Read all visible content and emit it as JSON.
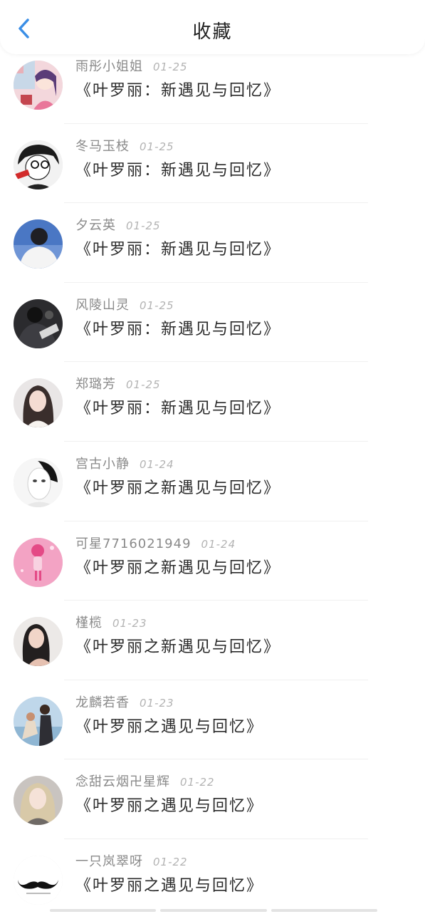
{
  "header": {
    "title": "收藏",
    "back_icon": "chevron-left-icon",
    "accent_color": "#3a8ee6"
  },
  "items": [
    {
      "username": "雨彤小姐姐",
      "date": "01-25",
      "title": "《叶罗丽：新遇见与回忆》",
      "avatar": "anime-girl-avatar"
    },
    {
      "username": "冬马玉枝",
      "date": "01-25",
      "title": "《叶罗丽：新遇见与回忆》",
      "avatar": "manga-boy-avatar"
    },
    {
      "username": "夕云英",
      "date": "01-25",
      "title": "《叶罗丽：新遇见与回忆》",
      "avatar": "boy-back-avatar"
    },
    {
      "username": "风陵山灵",
      "date": "01-25",
      "title": "《叶罗丽：新遇见与回忆》",
      "avatar": "dark-photo-avatar"
    },
    {
      "username": "郑璐芳",
      "date": "01-25",
      "title": "《叶罗丽：新遇见与回忆》",
      "avatar": "girl-photo-avatar"
    },
    {
      "username": "宫古小静",
      "date": "01-24",
      "title": "《叶罗丽之新遇见与回忆》",
      "avatar": "mask-avatar"
    },
    {
      "username": "可星7716021949",
      "date": "01-24",
      "title": "《叶罗丽之新遇见与回忆》",
      "avatar": "pink-anime-avatar"
    },
    {
      "username": "槿榄",
      "date": "01-23",
      "title": "《叶罗丽之新遇见与回忆》",
      "avatar": "woman-photo-avatar"
    },
    {
      "username": "龙麟若香",
      "date": "01-23",
      "title": "《叶罗丽之遇见与回忆》",
      "avatar": "couple-photo-avatar"
    },
    {
      "username": "念甜云烟卍星辉",
      "date": "01-22",
      "title": "《叶罗丽之遇见与回忆》",
      "avatar": "blonde-girl-avatar"
    },
    {
      "username": "一只岚翠呀",
      "date": "01-22",
      "title": "《叶罗丽之遇见与回忆》",
      "avatar": "mustache-avatar"
    }
  ]
}
